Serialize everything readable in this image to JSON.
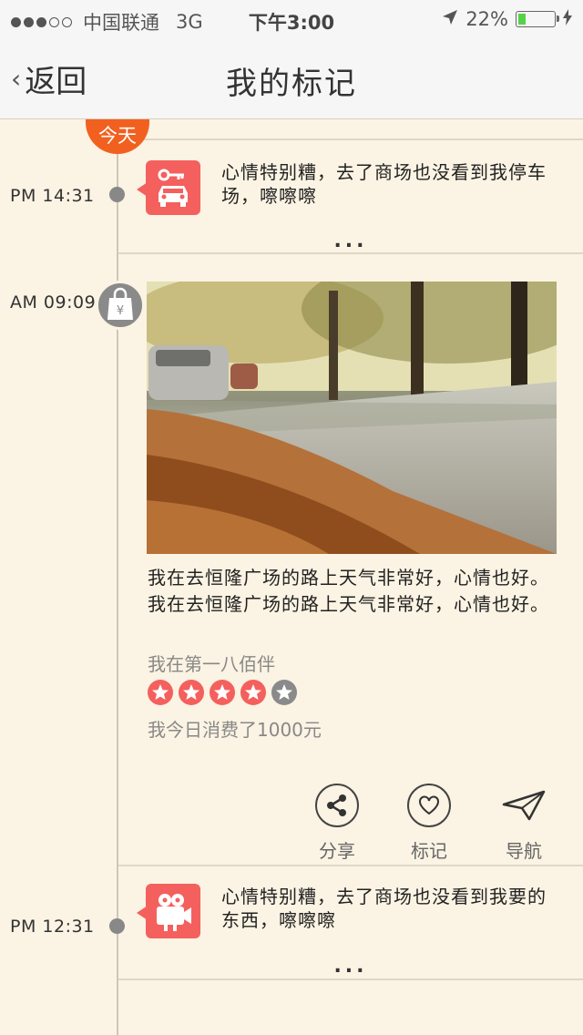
{
  "status_bar": {
    "signal_dots_filled": 3,
    "signal_dots_total": 5,
    "carrier": "中国联通",
    "network": "3G",
    "time": "下午3:00",
    "battery": "22%",
    "battery_level": 0.22,
    "battery_color": "#58d14a"
  },
  "nav": {
    "back_label": "返回",
    "title": "我的标记"
  },
  "timeline": {
    "today_badge": "今天",
    "accent_color": "#f2601f",
    "entries": [
      {
        "time": "PM  14:31",
        "icon": "car-key-icon",
        "text": "心情特别糟，去了商场也没看到我停车场，嚓嚓嚓",
        "more": "..."
      },
      {
        "time": "AM  09:09",
        "icon": "shopping-bag-icon",
        "photo": "autumn-road-photo",
        "text": "我在去恒隆广场的路上天气非常好，心情也好。我在去恒隆广场的路上天气非常好，心情也好。",
        "location": "我在第一八佰伴",
        "rating": 4,
        "rating_max": 5,
        "spend": "我今日消费了1000元",
        "actions": {
          "share": "分享",
          "mark": "标记",
          "navigate": "导航"
        }
      },
      {
        "time": "PM  12:31",
        "icon": "video-camera-icon",
        "text": "心情特别糟，去了商场也没看到我要的东西，嚓嚓嚓",
        "more": "..."
      }
    ]
  }
}
